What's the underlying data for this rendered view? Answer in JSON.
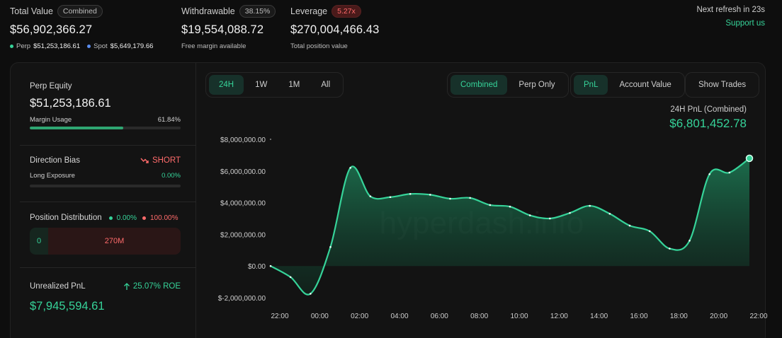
{
  "header": {
    "total_value": {
      "label": "Total Value",
      "badge": "Combined",
      "value": "$56,902,366.27",
      "perp_label": "Perp",
      "perp_value": "$51,253,186.61",
      "spot_label": "Spot",
      "spot_value": "$5,649,179.66"
    },
    "withdrawable": {
      "label": "Withdrawable",
      "badge": "38.15%",
      "value": "$19,554,088.72",
      "sub": "Free margin available"
    },
    "leverage": {
      "label": "Leverage",
      "badge": "5.27x",
      "value": "$270,004,466.43",
      "sub": "Total position value"
    },
    "refresh": "Next refresh in 23s",
    "support": "Support us"
  },
  "left": {
    "perp_equity_label": "Perp Equity",
    "perp_equity_value": "$51,253,186.61",
    "margin_usage_label": "Margin Usage",
    "margin_usage_value": "61.84%",
    "margin_usage_fraction": 0.6184,
    "direction_bias_label": "Direction Bias",
    "direction_bias_value": "SHORT",
    "long_exposure_label": "Long Exposure",
    "long_exposure_value": "0.00%",
    "position_distribution_label": "Position Distribution",
    "long_pct": "0.00%",
    "short_pct": "100.00%",
    "long_amount": "0",
    "short_amount": "270M",
    "unrealized_pnl_label": "Unrealized PnL",
    "roe": "25.07% ROE",
    "unrealized_pnl_value": "$7,945,594.61"
  },
  "controls": {
    "time_tabs": [
      "24H",
      "1W",
      "1M",
      "All"
    ],
    "active_time": "24H",
    "view_tabs": [
      "Combined",
      "Perp Only"
    ],
    "active_view": "Combined",
    "metric_tabs": [
      "PnL",
      "Account Value"
    ],
    "active_metric": "PnL",
    "show_trades": "Show Trades"
  },
  "pnl_summary": {
    "label": "24H PnL (Combined)",
    "value": "$6,801,452.78"
  },
  "watermark": "hyperdash.info",
  "colors": {
    "accent": "#36d399",
    "negative": "#ff6b6b"
  },
  "chart_data": {
    "type": "area",
    "x": [
      "22:00",
      "23:00",
      "00:00",
      "01:00",
      "02:00",
      "03:00",
      "04:00",
      "05:00",
      "06:00",
      "07:00",
      "08:00",
      "09:00",
      "10:00",
      "11:00",
      "12:00",
      "13:00",
      "14:00",
      "15:00",
      "16:00",
      "17:00",
      "18:00",
      "19:00",
      "20:00",
      "21:00",
      "22:00"
    ],
    "tick_labels": [
      "22:00",
      "00:00",
      "02:00",
      "04:00",
      "06:00",
      "08:00",
      "10:00",
      "12:00",
      "14:00",
      "16:00",
      "18:00",
      "20:00",
      "22:00"
    ],
    "series": [
      {
        "values": [
          0,
          -700000,
          -1750000,
          1200000,
          6200000,
          4400000,
          4350000,
          4550000,
          4500000,
          4250000,
          4300000,
          3850000,
          3750000,
          3200000,
          3000000,
          3350000,
          3800000,
          3300000,
          2550000,
          2200000,
          1100000,
          1600000,
          5800000,
          5900000,
          6800000
        ]
      }
    ],
    "ylim": [
      -2000000,
      8000000
    ],
    "y_ticks": [
      "$-2,000,000.00",
      "$0.00",
      "$2,000,000.00",
      "$4,000,000.00",
      "$6,000,000.00",
      "$8,000,000.00"
    ],
    "y_tick_values": [
      -2000000,
      0,
      2000000,
      4000000,
      6000000,
      8000000
    ],
    "grid": false
  }
}
